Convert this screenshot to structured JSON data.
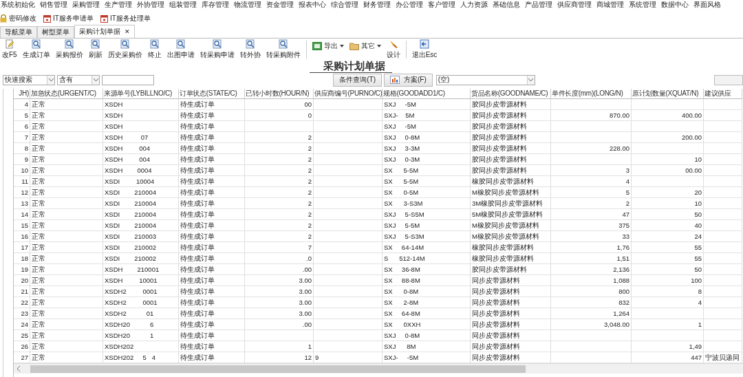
{
  "menu_bar": [
    "系统初始化",
    "销售管理",
    "采购管理",
    "生产管理",
    "外协管理",
    "组装管理",
    "库存管理",
    "物流管理",
    "资金管理",
    "报表中心",
    "综合管理",
    "财务管理",
    "办公管理",
    "客户管理",
    "人力资源",
    "基础信息",
    "产品管理",
    "供应商管理",
    "商城管理",
    "系统管理",
    "数据中心",
    "界面风格"
  ],
  "quick_links": [
    {
      "label": "密码修改",
      "kind": "password"
    },
    {
      "label": "IT服务申请单",
      "kind": "service"
    },
    {
      "label": "IT服务处理单",
      "kind": "service"
    }
  ],
  "tabs": [
    {
      "label": "导航菜单",
      "selected": false,
      "closable": false
    },
    {
      "label": "树型菜单",
      "selected": false,
      "closable": false
    },
    {
      "label": "采购计划单据",
      "selected": true,
      "closable": true,
      "close": "✕"
    }
  ],
  "toolbar": [
    {
      "label": "改F5",
      "kind": "edit"
    },
    {
      "label": "生成订单",
      "kind": "command"
    },
    {
      "label": "采购报价",
      "kind": "command"
    },
    {
      "label": "刷新",
      "kind": "command"
    },
    {
      "label": "历史采购价",
      "kind": "command"
    },
    {
      "label": "终止",
      "kind": "command"
    },
    {
      "label": "出图申请",
      "kind": "command"
    },
    {
      "label": "转采购申请",
      "kind": "command"
    },
    {
      "label": "转外协",
      "kind": "command"
    },
    {
      "label": "转采购附件",
      "kind": "command"
    },
    {
      "label": "导出",
      "kind": "export"
    },
    {
      "label": "其它",
      "kind": "other"
    },
    {
      "label": "设计",
      "kind": "design"
    },
    {
      "label": "退出Esc",
      "kind": "exit"
    }
  ],
  "page_title": "采购计划单据",
  "search": {
    "field": "快速搜索",
    "operator": "含有",
    "query_button": "条件查询(T)",
    "scheme_button": "方案(F)",
    "scheme_value": "(空)"
  },
  "table": {
    "columns": [
      "JH)",
      "加急状态(URGENT/C)",
      "来源单号(LYBILLNO/C)",
      "订单状态(STATE/C)",
      "已转小时数(HOUR/N)",
      "供应商编号(PURNO/C)",
      "规格(GOODADD1/C)",
      "货品名称(GOODNAME/C)",
      "单件长度(mm)(LONG/N)",
      "原计划数量(XQUAT/N)",
      "建议供应"
    ],
    "rows": [
      [
        "4",
        "正常",
        "XSDH",
        "待生成订单",
        "00",
        "",
        "SXJ     -5M",
        "胶同步皮带源材料",
        "",
        "",
        ""
      ],
      [
        "5",
        "正常",
        "XSDH",
        "待生成订单",
        "0",
        "",
        "SXJ-    5M",
        "胶同步皮带源材料",
        "870.00",
        "400.00",
        ""
      ],
      [
        "6",
        "正常",
        "XSDH",
        "待生成订单",
        "",
        "",
        "SXJ     -5M",
        "胶同步皮带源材料",
        "",
        "",
        ""
      ],
      [
        "7",
        "正常",
        "XSDH          07",
        "待生成订单",
        "2",
        "",
        "SXJ     0-8M",
        "胶同步皮带源材料",
        "",
        "200.00",
        ""
      ],
      [
        "8",
        "正常",
        "XSDH         004",
        "待生成订单",
        "2",
        "",
        "SXJ     3-3M",
        "胶同步皮带源材料",
        "228.00",
        "",
        ""
      ],
      [
        "9",
        "正常",
        "XSDH         004",
        "待生成订单",
        "2",
        "",
        "SXJ     0-3M",
        "胶同步皮带源材料",
        "",
        "10",
        ""
      ],
      [
        "10",
        "正常",
        "XSDH        0004",
        "待生成订单",
        "2",
        "",
        "SX      5-5M",
        "胶同步皮带源材料",
        "3",
        "00.00",
        ""
      ],
      [
        "11",
        "正常",
        "XSDI         10004",
        "待生成订单",
        "2",
        "",
        "SX      5-5M",
        "橡胶同步皮带源材料",
        "4",
        "",
        ""
      ],
      [
        "12",
        "正常",
        "XSDI        210004",
        "待生成订单",
        "2",
        "",
        "SX      0-5M",
        "M橡胶同步皮带源材料",
        "5",
        "20",
        ""
      ],
      [
        "13",
        "正常",
        "XSDI        210004",
        "待生成订单",
        "2",
        "",
        "SX      3-S3M",
        "3M橡胶同步皮带源材料",
        "2",
        "10",
        ""
      ],
      [
        "14",
        "正常",
        "XSDI        210004",
        "待生成订单",
        "2",
        "",
        "SXJ     5-S5M",
        "5M橡胶同步皮带源材料",
        "47",
        "50",
        ""
      ],
      [
        "15",
        "正常",
        "XSDI        210004",
        "待生成订单",
        "2",
        "",
        "SXJ     5-5M",
        "M橡胶同步皮带源材料",
        "375",
        "40",
        ""
      ],
      [
        "16",
        "正常",
        "XSDI        210003",
        "待生成订单",
        "2",
        "",
        "SXJ     5-S3M",
        "M橡胶同步皮带源材料",
        "33",
        "24",
        ""
      ],
      [
        "17",
        "正常",
        "XSDI        210002",
        "待生成订单",
        "7",
        "",
        "SX     64-14M",
        "橡胶同步皮带源材料",
        "1,76",
        "55",
        ""
      ],
      [
        "18",
        "正常",
        "XSDI        210002",
        "待生成订单",
        ".0",
        "",
        "S      512-14M",
        "橡胶同步皮带源材料",
        "1,51",
        "55",
        ""
      ],
      [
        "19",
        "正常",
        "XSDH        210001",
        "待生成订单",
        ".00",
        "",
        "SX     36-8M",
        "胶同步皮带源材料",
        "2,136",
        "50",
        ""
      ],
      [
        "20",
        "正常",
        "XSDH         10001",
        "待生成订单",
        "3.00",
        "",
        "SX     88-8M",
        "同步皮带源材料",
        "1,088",
        "100",
        ""
      ],
      [
        "21",
        "正常",
        "XSDH2         0001",
        "待生成订单",
        "3.00",
        "",
        "SX      0-8M",
        "同步皮带源材料",
        "800",
        "8",
        ""
      ],
      [
        "22",
        "正常",
        "XSDH2         0001",
        "待生成订单",
        "3.00",
        "",
        "SX      2-8M",
        "同步皮带源材料",
        "832",
        "4",
        ""
      ],
      [
        "23",
        "正常",
        "XSDH2           01",
        "待生成订单",
        "3.00",
        "",
        "SX     64-8M",
        "同步皮带源材料",
        "1,264",
        "",
        ""
      ],
      [
        "24",
        "正常",
        "XSDH20           6",
        "待生成订单",
        ".00",
        "",
        "SX      0XXH",
        "同步皮带源材料",
        "3,048.00",
        "1",
        ""
      ],
      [
        "25",
        "正常",
        "XSDH20           1",
        "待生成订单",
        "",
        "",
        "SXJ     0-8M",
        "同步皮带源材料",
        "",
        "",
        ""
      ],
      [
        "26",
        "正常",
        "XSDH202",
        "待生成订单",
        "1",
        "",
        "SXJ      8M",
        "同步皮带源材料",
        "",
        "1,49",
        ""
      ],
      [
        "27",
        "正常",
        "XSDH202     5   4",
        "待生成订单",
        "12",
        "9",
        "SXJ-     -5M",
        "同步皮带源材料",
        "",
        "447",
        "宁波贝递同"
      ]
    ]
  }
}
